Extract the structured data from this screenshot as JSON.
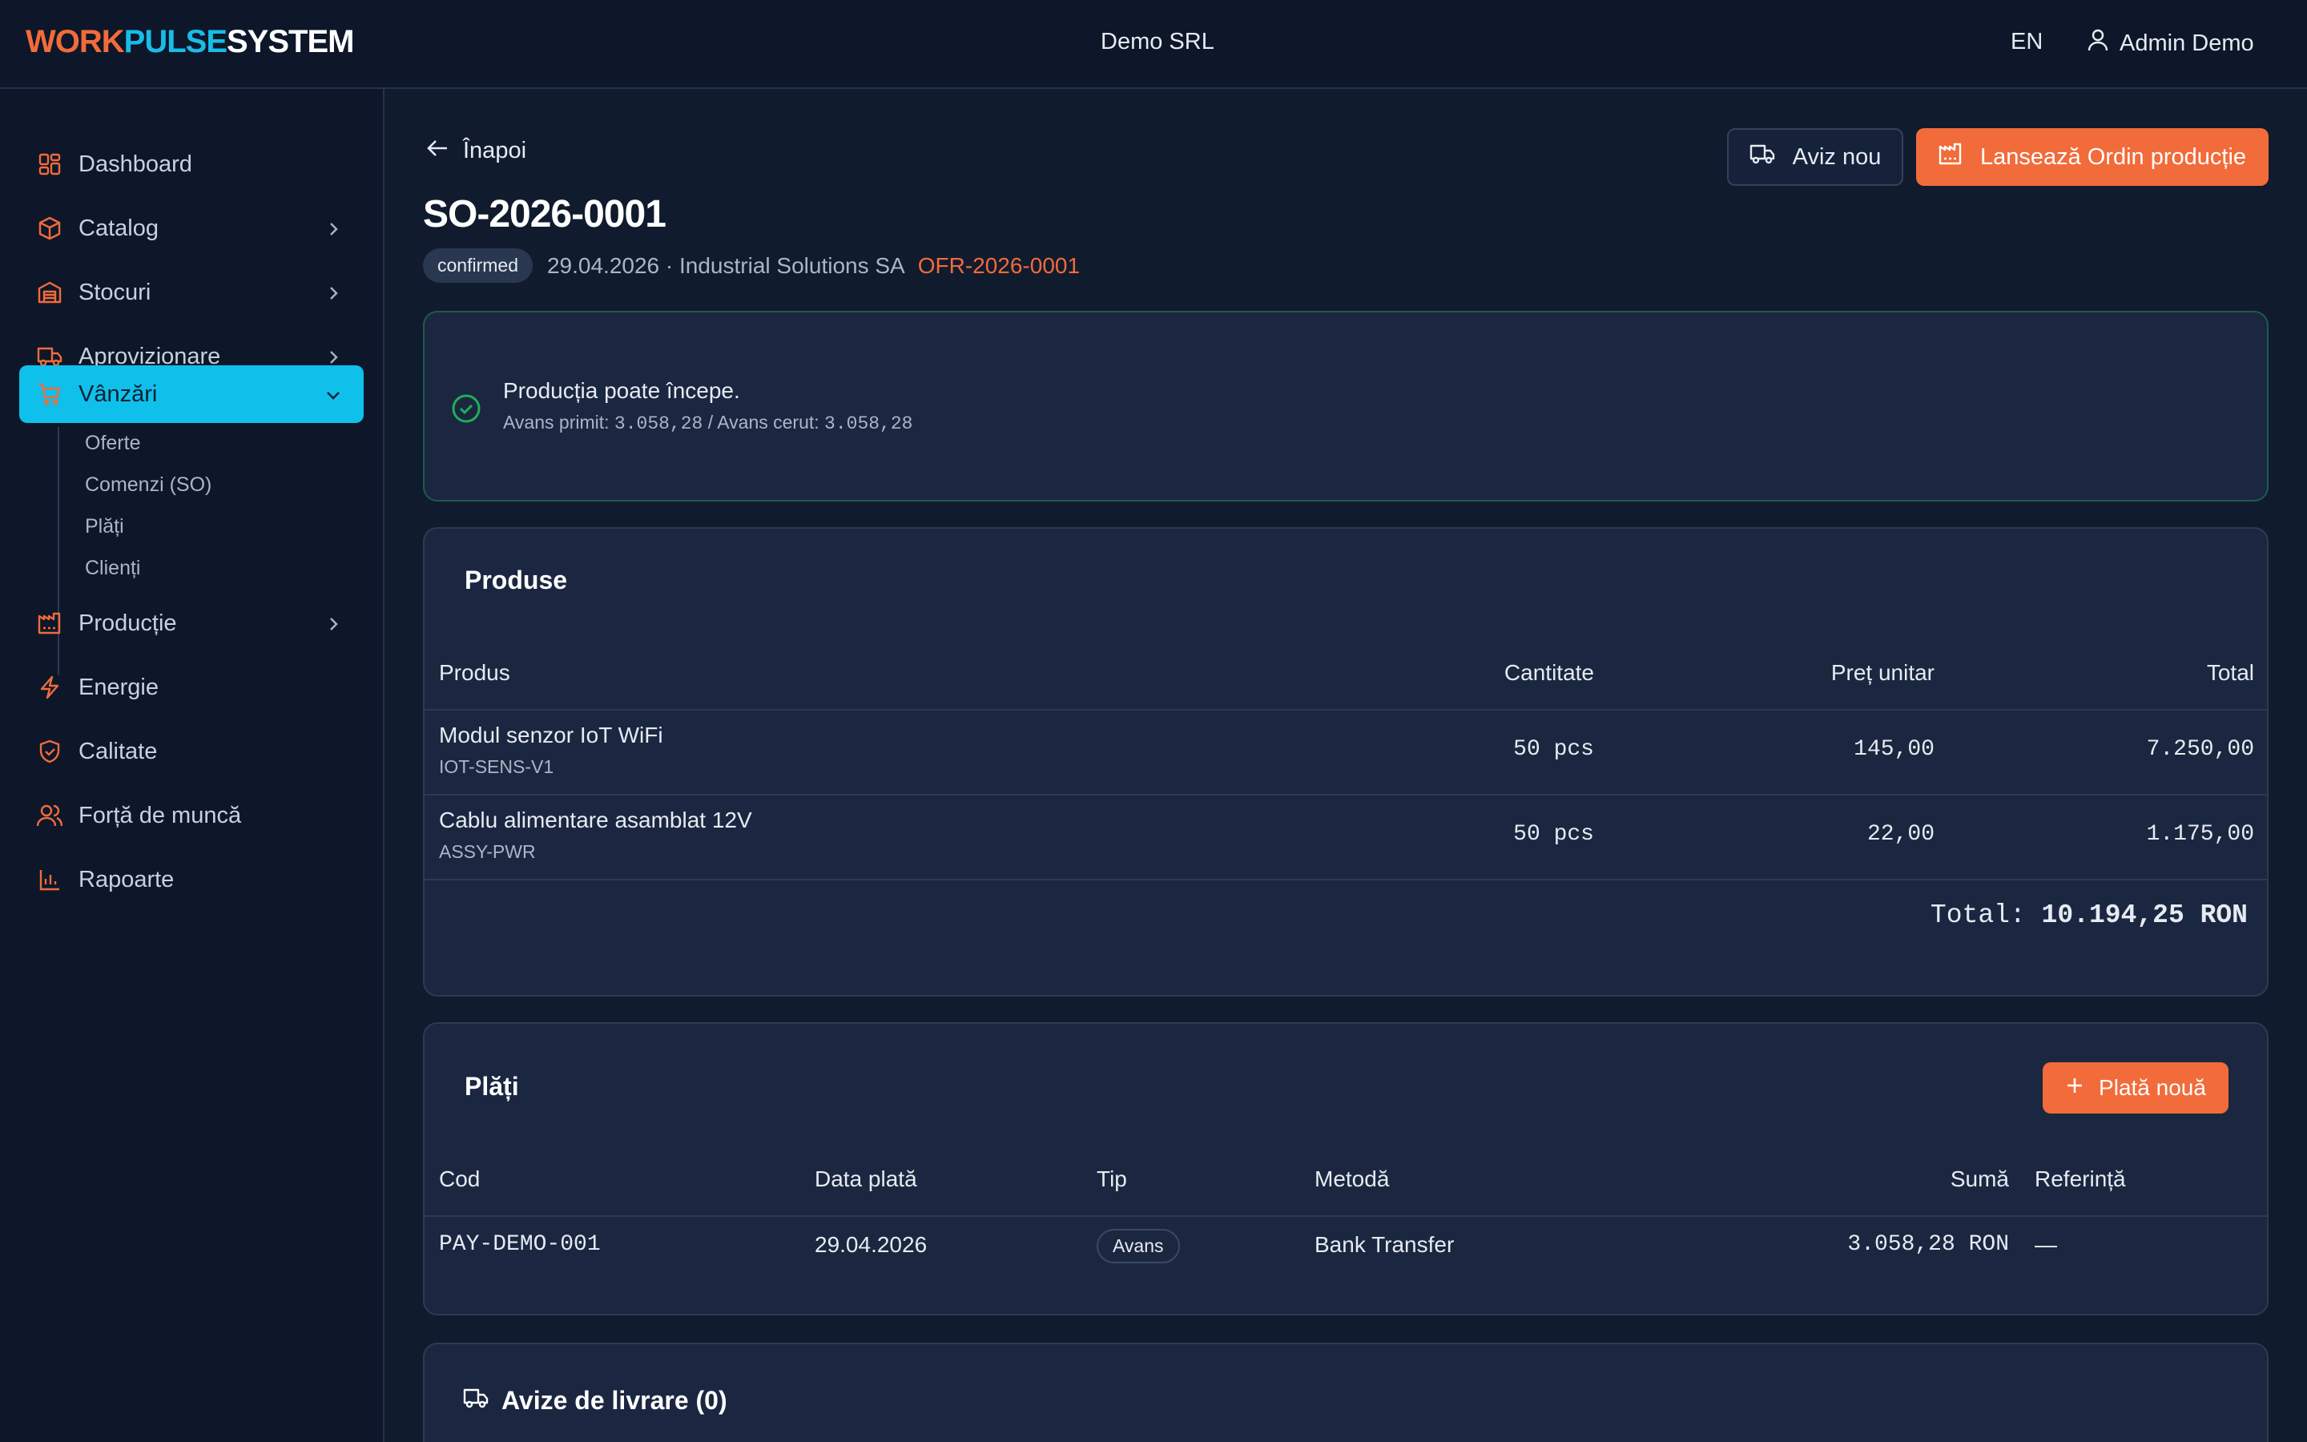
{
  "header": {
    "logo": {
      "part1": "WORK",
      "part2": "PULSE",
      "part3": "SYSTEM"
    },
    "company": "Demo SRL",
    "language": "EN",
    "user": "Admin Demo"
  },
  "sidebar": {
    "items": [
      {
        "label": "Dashboard",
        "icon": "dashboard-icon"
      },
      {
        "label": "Catalog",
        "icon": "box-icon"
      },
      {
        "label": "Stocuri",
        "icon": "warehouse-icon"
      },
      {
        "label": "Aprovizionare",
        "icon": "truck-icon"
      },
      {
        "label": "Vânzări",
        "icon": "cart-icon",
        "active": true
      },
      {
        "label": "Producție",
        "icon": "factory-icon"
      },
      {
        "label": "Energie",
        "icon": "bolt-icon"
      },
      {
        "label": "Calitate",
        "icon": "shield-icon"
      },
      {
        "label": "Forță de muncă",
        "icon": "users-icon"
      },
      {
        "label": "Rapoarte",
        "icon": "bar-chart-icon"
      }
    ],
    "sub_items": [
      "Oferte",
      "Comenzi (SO)",
      "Plăți",
      "Clienți"
    ]
  },
  "page": {
    "back_label": "Înapoi",
    "new_notice_label": "Aviz nou",
    "launch_order_label": "Lansează Ordin producție",
    "title": "SO-2026-0001",
    "status": "confirmed",
    "meta_text": "29.04.2026 · Industrial Solutions SA",
    "offer_link": "OFR-2026-0001"
  },
  "alert": {
    "title": "Producția poate începe.",
    "advance_received_label": "Avans primit:",
    "advance_received_value": "3.058,28",
    "separator": " / ",
    "advance_required_label": "Avans cerut:",
    "advance_required_value": "3.058,28"
  },
  "products": {
    "title": "Produse",
    "columns": {
      "product": "Produs",
      "quantity": "Cantitate",
      "unit_price": "Preț unitar",
      "total": "Total"
    },
    "rows": [
      {
        "name": "Modul senzor IoT WiFi",
        "code": "IOT-SENS-V1",
        "quantity": "50 pcs",
        "unit_price": "145,00",
        "total": "7.250,00"
      },
      {
        "name": "Cablu alimentare asamblat 12V",
        "code": "ASSY-PWR",
        "quantity": "50 pcs",
        "unit_price": "22,00",
        "total": "1.175,00"
      }
    ],
    "total_label": "Total:",
    "total_value": "10.194,25 RON"
  },
  "payments": {
    "title": "Plăți",
    "new_payment_label": "Plată nouă",
    "columns": {
      "code": "Cod",
      "date": "Data plată",
      "type": "Tip",
      "method": "Metodă",
      "amount": "Sumă",
      "reference": "Referință"
    },
    "rows": [
      {
        "code": "PAY-DEMO-001",
        "date": "29.04.2026",
        "type": "Avans",
        "method": "Bank Transfer",
        "amount": "3.058,28 RON",
        "reference": "—"
      }
    ]
  },
  "deliveries": {
    "title": "Avize de livrare (0)"
  },
  "colors": {
    "accent": "#f26b3a",
    "active_nav": "#0fc0ea",
    "background": "#111b2e",
    "card": "#1b2740",
    "success": "#1fae5b"
  }
}
